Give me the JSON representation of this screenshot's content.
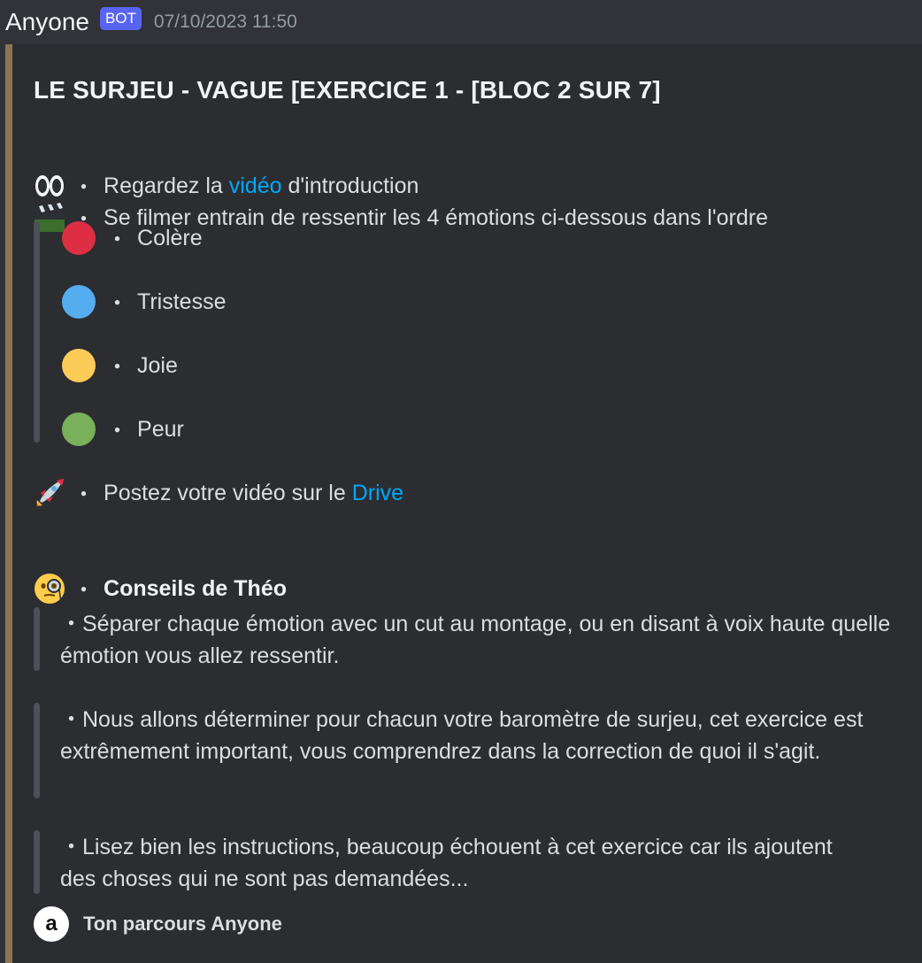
{
  "message": {
    "author": "Anyone",
    "bot_tag": "BOT",
    "timestamp": "07/10/2023 11:50"
  },
  "embed": {
    "accent_color": "#8a7654",
    "title": "LE SURJEU - VAGUE [EXERCICE 1 - [BLOC 2 SUR 7]",
    "intro": {
      "bullet": "・",
      "watch_prefix": "Regardez la ",
      "watch_link": "vidéo",
      "watch_suffix": " d'introduction",
      "film_text": "Se filmer entrain de ressentir les 4 émotions ci-dessous dans l'ordre"
    },
    "emotions": [
      {
        "label": "Colère",
        "color": "#dd2e44",
        "icon": "red-circle-icon"
      },
      {
        "label": "Tristesse",
        "color": "#55acee",
        "icon": "blue-circle-icon"
      },
      {
        "label": "Joie",
        "color": "#fdcb58",
        "icon": "yellow-circle-icon"
      },
      {
        "label": "Peur",
        "color": "#78b159",
        "icon": "green-circle-icon"
      }
    ],
    "post": {
      "prefix": "Postez votre vidéo sur le ",
      "link": "Drive"
    },
    "tips": {
      "heading": "Conseils de Théo",
      "items": [
        "・Séparer chaque émotion avec un cut au montage, ou en disant à voix haute quelle émotion vous allez ressentir.",
        "・Nous allons déterminer pour chacun votre baromètre de surjeu, cet exercice est extrêmement important, vous comprendrez dans la correction de quoi il s'agit.",
        "・Lisez bien les instructions, beaucoup échouent à cet exercice car ils ajoutent des choses qui ne sont pas demandées..."
      ]
    },
    "footer": {
      "icon_letter": "a",
      "text": "Ton parcours Anyone"
    }
  },
  "colors": {
    "background": "#313338",
    "embed_background": "#2b2d31",
    "link": "#00a8fc",
    "bot_tag": "#5865f2"
  }
}
